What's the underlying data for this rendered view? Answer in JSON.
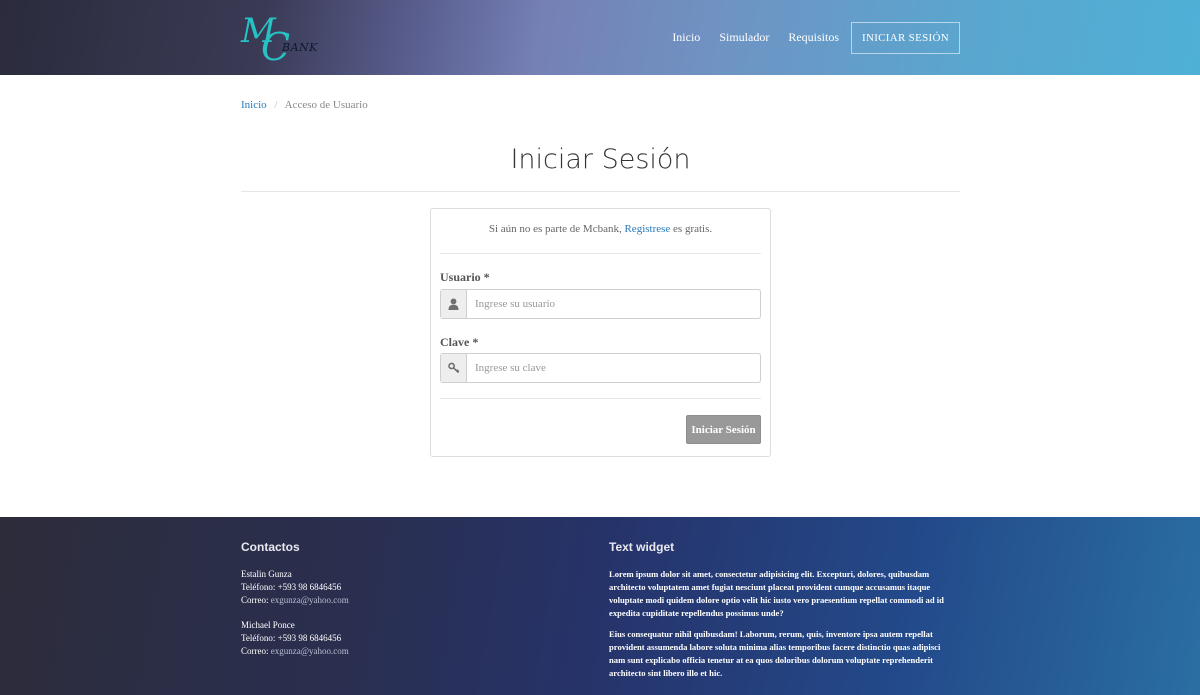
{
  "header": {
    "logo": {
      "letter_m": "M",
      "letter_c": "C",
      "word": "BANK"
    },
    "nav": {
      "home": "Inicio",
      "simulator": "Simulador",
      "requirements": "Requisitos",
      "login": "INICIAR SESIÓN"
    }
  },
  "breadcrumb": {
    "home": "Inicio",
    "separator": "/",
    "current": "Acceso de Usuario"
  },
  "page_title": "Iniciar Sesión",
  "login_form": {
    "intro_prefix": "Si aún no es parte de Mcbank,",
    "register_link": "Registrese",
    "intro_suffix": "es gratis.",
    "username_label": "Usuario *",
    "username_placeholder": "Ingrese su usuario",
    "username_value": "",
    "password_label": "Clave *",
    "password_placeholder": "Ingrese su clave",
    "password_value": "",
    "submit_label": "Iniciar Sesión"
  },
  "footer": {
    "contacts_title": "Contactos",
    "contacts": [
      {
        "name": "Estalin Gunza",
        "phone": "Teléfono: +593 98 6846456",
        "email_label": "Correo:",
        "email": "exgunza@yahoo.com"
      },
      {
        "name": "Michael Ponce",
        "phone": "Teléfono: +593 98 6846456",
        "email_label": "Correo:",
        "email": "exgunza@yahoo.com"
      }
    ],
    "widget_title": "Text widget",
    "widget_paragraphs": [
      "Lorem ipsum dolor sit amet, consectetur adipisicing elit. Excepturi, dolores, quibusdam architecto voluptatem amet fugiat nesciunt placeat provident cumque accusamus itaque voluptate modi quidem dolore optio velit hic iusto vero praesentium repellat commodi ad id expedita cupiditate repellendus possimus unde?",
      "Eius consequatur nihil quibusdam! Laborum, rerum, quis, inventore ipsa autem repellat provident assumenda labore soluta minima alias temporibus facere distinctio quas adipisci nam sunt explicabo officia tenetur at ea quos doloribus dolorum voluptate reprehenderit architecto sint libero illo et hic."
    ]
  },
  "colors": {
    "accent_teal": "#27c2c4",
    "link_blue": "#2a7ab7",
    "button_gray": "#999999"
  },
  "icons": {
    "username_addon": "user-icon",
    "password_addon": "key-icon"
  }
}
